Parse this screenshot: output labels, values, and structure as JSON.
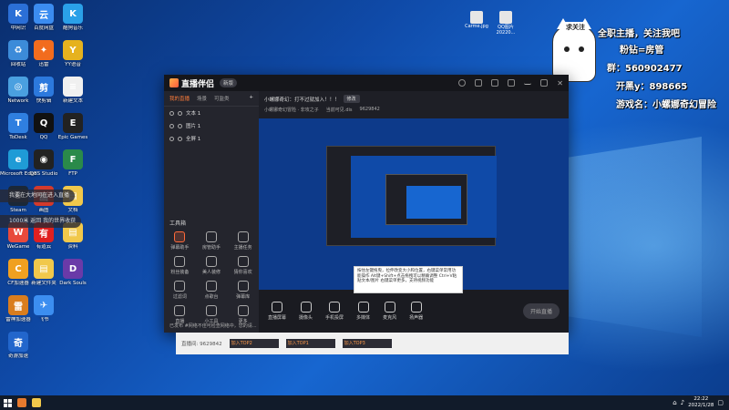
{
  "desktop": {
    "icons_col1": [
      {
        "label": "中网识",
        "color": "#2b6fd6",
        "glyph": "K"
      },
      {
        "label": "回收站",
        "color": "#3c8bd9",
        "glyph": "♻"
      },
      {
        "label": "Network",
        "color": "#4aa0e0",
        "glyph": "◎"
      },
      {
        "label": "ToDesk",
        "color": "#2f7fe0",
        "glyph": "T"
      },
      {
        "label": "Microsoft Edge",
        "color": "#1f9bd6",
        "glyph": "e"
      },
      {
        "label": "Steam",
        "color": "#1b2838",
        "glyph": "S"
      },
      {
        "label": "WeGame",
        "color": "#e84a3c",
        "glyph": "W"
      },
      {
        "label": "CF加速器",
        "color": "#f0a020",
        "glyph": "C"
      },
      {
        "label": "雷神加速器",
        "color": "#d97d1e",
        "glyph": "雷"
      },
      {
        "label": "奇游加速",
        "color": "#2266cc",
        "glyph": "奇"
      }
    ],
    "icons_col2": [
      {
        "label": "百度网盘",
        "color": "#3b8cf0",
        "glyph": "云"
      },
      {
        "label": "迅雷",
        "color": "#f26c1e",
        "glyph": "✦"
      },
      {
        "label": "快剪辑",
        "color": "#2c79dd",
        "glyph": "剪"
      },
      {
        "label": "QQ",
        "color": "#111111",
        "glyph": "Q"
      },
      {
        "label": "OBS Studio",
        "color": "#222222",
        "glyph": "◉"
      },
      {
        "label": "画图",
        "color": "#d33a2c",
        "glyph": "画"
      },
      {
        "label": "有道云",
        "color": "#e02020",
        "glyph": "有"
      },
      {
        "label": "新建文件夹",
        "color": "#f1c84b",
        "glyph": "▤"
      },
      {
        "label": "飞书",
        "color": "#3c8ef0",
        "glyph": "✈"
      }
    ],
    "icons_col3": [
      {
        "label": "酷狗音乐",
        "color": "#2aa0e8",
        "glyph": "K"
      },
      {
        "label": "YY语音",
        "color": "#e6b21e",
        "glyph": "Y"
      },
      {
        "label": "新建文本",
        "color": "#f0f0f0",
        "glyph": "≡"
      },
      {
        "label": "Epic Games",
        "color": "#222222",
        "glyph": "E"
      },
      {
        "label": "FTP",
        "color": "#2a8a4a",
        "glyph": "F"
      },
      {
        "label": "文档",
        "color": "#f1c84b",
        "glyph": "▤"
      },
      {
        "label": "资料",
        "color": "#f1c84b",
        "glyph": "▤"
      },
      {
        "label": "Dark Souls",
        "color": "#6a3aa8",
        "glyph": "D"
      }
    ],
    "top_files": [
      "Carme.jpg",
      "QQ图片 20220..."
    ],
    "notifications": [
      "我要在大地同在进入直播",
      "1000米 返回 我的世界收获"
    ]
  },
  "streamer_card": {
    "tag": "求关注",
    "headline": "全职主播，关注我吧",
    "fans_line": "粉钻=房管",
    "group_line": "群：560902477",
    "kaihei_line": "开黑y：898665",
    "game_line": "游戏名：小螺娜奇幻冒险"
  },
  "app": {
    "title": "直播伴侣",
    "badge": "新版",
    "tabs": [
      "我的直播",
      "场景",
      "可监类"
    ],
    "layers": [
      "文本 1",
      "图片 1",
      "全屏 1"
    ],
    "tools_title": "工具箱",
    "tools": [
      "弹幕助手",
      "房管助手",
      "主播任务",
      "粉丝装备",
      "美人装修",
      "猜你喜欢",
      "过滤词",
      "点歌台",
      "弹幕库",
      "直播",
      "小工具",
      "更多"
    ],
    "footer": "已发布 #网络不佳可检查网络中，您的请...",
    "preview_notice": "小螺娜奇幻：打不过就加入！！！",
    "preview_notice_btn": "修改",
    "preview_meta": [
      "小螺娜奇幻冒险 · 非攻之子",
      "当前可见.dis",
      "9629842"
    ],
    "bottom_controls": [
      "直播屏幕",
      "摄像头",
      "手机投屏",
      "多媒体",
      "麦克风",
      "扬声器"
    ],
    "start_button": "开始直播",
    "tooltip": "按住左键拖曳，拉伸改变大小和位置，右键菜单常用功能操作 Alt键+Shift+点击拖拽可以精确调整 Ctrl+V粘贴文本/图片 右键菜单更多，支持视频功能",
    "below_thumbs": [
      "加入TOP2",
      "加入TOP1",
      "加入TOP3"
    ],
    "below_meta": "直播间: 9629842"
  },
  "taskbar": {
    "time": "22:22",
    "date": "2022/1/28"
  }
}
